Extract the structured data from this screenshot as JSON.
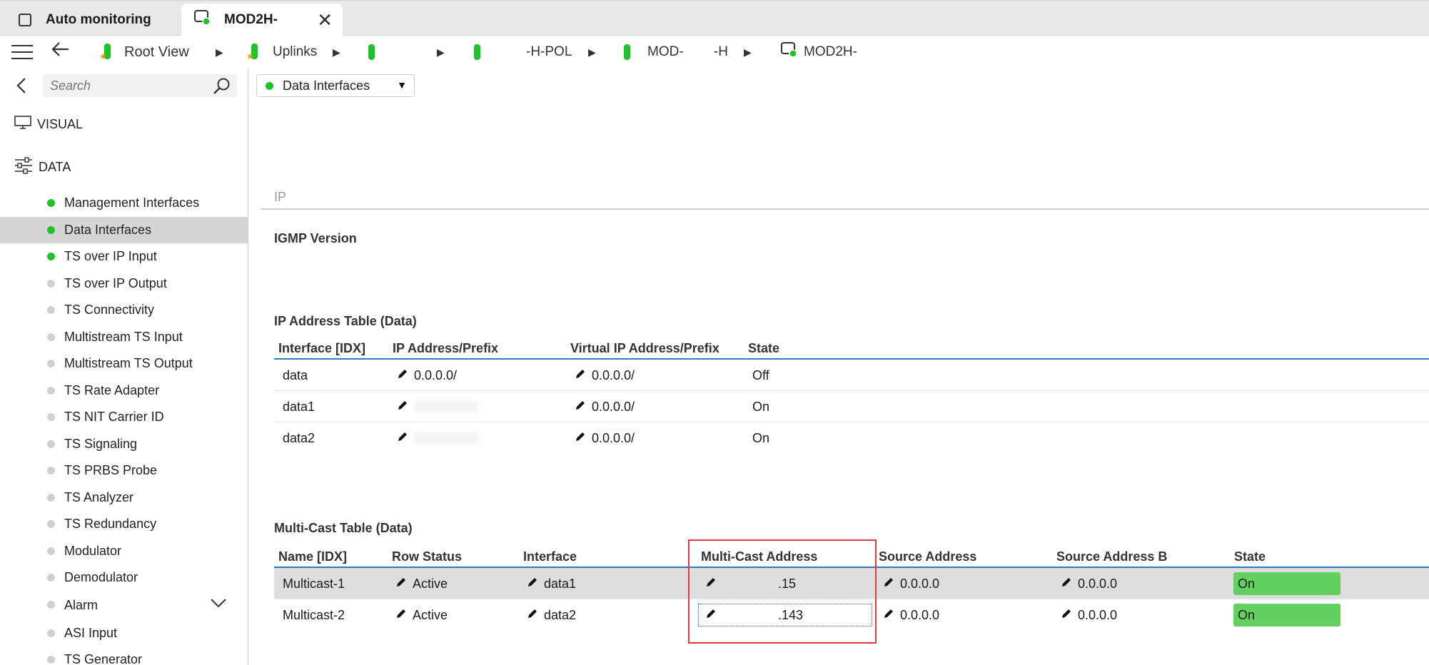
{
  "tabs": [
    {
      "label": "Auto monitoring"
    },
    {
      "label": "MOD2H-"
    }
  ],
  "breadcrumb": [
    {
      "label": "Root View"
    },
    {
      "label": "Uplinks"
    },
    {
      "label": ""
    },
    {
      "label": "-H-POL"
    },
    {
      "label": "MOD-        -H"
    },
    {
      "label": "MOD2H-"
    }
  ],
  "sidebar": {
    "search_placeholder": "Search",
    "visual_label": "VISUAL",
    "data_label": "DATA",
    "items": [
      {
        "label": "Management Interfaces",
        "status": "green",
        "selected": false
      },
      {
        "label": "Data Interfaces",
        "status": "green",
        "selected": true
      },
      {
        "label": "TS over IP Input",
        "status": "green",
        "selected": false
      },
      {
        "label": "TS over IP Output",
        "status": "grey",
        "selected": false
      },
      {
        "label": "TS Connectivity",
        "status": "grey",
        "selected": false
      },
      {
        "label": "Multistream TS Input",
        "status": "grey",
        "selected": false
      },
      {
        "label": "Multistream TS Output",
        "status": "grey",
        "selected": false
      },
      {
        "label": "TS Rate Adapter",
        "status": "grey",
        "selected": false
      },
      {
        "label": "TS NIT Carrier ID",
        "status": "grey",
        "selected": false
      },
      {
        "label": "TS Signaling",
        "status": "grey",
        "selected": false
      },
      {
        "label": "TS PRBS Probe",
        "status": "grey",
        "selected": false
      },
      {
        "label": "TS Analyzer",
        "status": "grey",
        "selected": false
      },
      {
        "label": "TS Redundancy",
        "status": "grey",
        "selected": false
      },
      {
        "label": "Modulator",
        "status": "grey",
        "selected": false
      },
      {
        "label": "Demodulator",
        "status": "grey",
        "selected": false
      },
      {
        "label": "Alarm",
        "status": "grey",
        "selected": false,
        "expandable": true
      },
      {
        "label": "ASI Input",
        "status": "grey",
        "selected": false
      },
      {
        "label": "TS Generator",
        "status": "grey",
        "selected": false
      }
    ]
  },
  "main": {
    "view_selector": "Data Interfaces",
    "ip_section": "IP",
    "igmp_heading": "IGMP Version",
    "ip_table": {
      "title": "IP Address Table (Data)",
      "columns": [
        "Interface [IDX]",
        "IP Address/Prefix",
        "Virtual IP Address/Prefix",
        "State"
      ],
      "rows": [
        {
          "iface": "data",
          "ip": "0.0.0.0/",
          "vip": "0.0.0.0/",
          "state": "Off"
        },
        {
          "iface": "data1",
          "ip": "",
          "vip": "0.0.0.0/",
          "state": "On"
        },
        {
          "iface": "data2",
          "ip": "",
          "vip": "0.0.0.0/",
          "state": "On"
        }
      ]
    },
    "mc_table": {
      "title": "Multi-Cast Table (Data)",
      "columns": [
        "Name [IDX]",
        "Row Status",
        "Interface",
        "Multi-Cast Address",
        "Source Address",
        "Source Address B",
        "State"
      ],
      "rows": [
        {
          "name": "Multicast-1",
          "row_status": "Active",
          "iface": "data1",
          "mcast": ".15",
          "src": "0.0.0.0",
          "srcb": "0.0.0.0",
          "state": "On"
        },
        {
          "name": "Multicast-2",
          "row_status": "Active",
          "iface": "data2",
          "mcast": ".143",
          "src": "0.0.0.0",
          "srcb": "0.0.0.0",
          "state": "On"
        }
      ]
    }
  },
  "colors": {
    "status_green": "#1fc22a",
    "state_on": "#63d160",
    "header_line": "#2d7bbd",
    "highlight_box": "#e23a3a"
  }
}
